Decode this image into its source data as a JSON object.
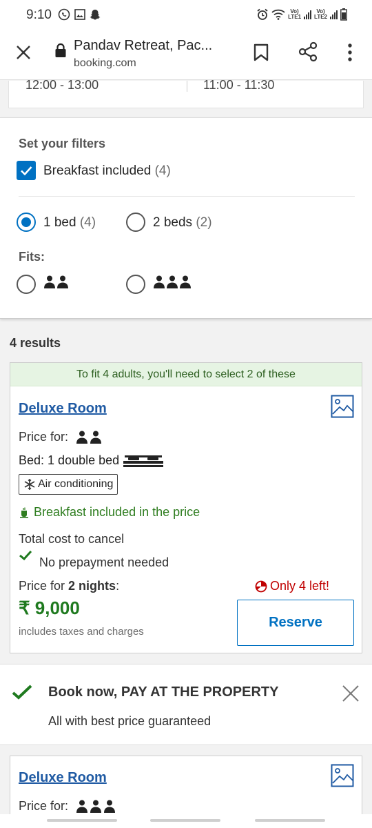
{
  "status_bar": {
    "time": "9:10",
    "net1_top": "Vo)",
    "net1_bottom": "LTE1",
    "net2_top": "Vo)",
    "net2_bottom": "LTE2"
  },
  "browser": {
    "page_title": "Pandav Retreat, Pac...",
    "domain": "booking.com"
  },
  "checkin": {
    "check_in_time": "12:00 - 13:00",
    "check_out_time": "11:00 - 11:30"
  },
  "filters": {
    "title": "Set your filters",
    "breakfast_label": "Breakfast included",
    "breakfast_count": "(4)",
    "beds": [
      {
        "label": "1 bed",
        "count": "(4)"
      },
      {
        "label": "2 beds",
        "count": "(2)"
      }
    ],
    "fits_label": "Fits:"
  },
  "results": {
    "count_label": "4 results"
  },
  "room1": {
    "notice": "To fit 4 adults, you'll need to select 2 of these",
    "title": "Deluxe Room",
    "price_for_label": "Price for:",
    "bed_label": "Bed:",
    "bed_value": "1 double bed",
    "amenity": "Air conditioning",
    "breakfast": "Breakfast included in the price",
    "cancel_title": "Total cost to cancel",
    "prepayment": "No prepayment needed",
    "nights_prefix": "Price for",
    "nights_value": "2 nights",
    "nights_suffix": ":",
    "only_left": "Only 4 left!",
    "price": "₹ 9,000",
    "taxes": "includes taxes and charges",
    "reserve_label": "Reserve"
  },
  "promo": {
    "title": "Book now, PAY AT THE PROPERTY",
    "subtitle": "All with best price guaranteed"
  },
  "room2": {
    "title": "Deluxe Room",
    "price_for_label": "Price for:"
  },
  "colors": {
    "brand_blue": "#0071c2",
    "success_green": "#1f7a1f",
    "alert_red": "#c00000"
  }
}
